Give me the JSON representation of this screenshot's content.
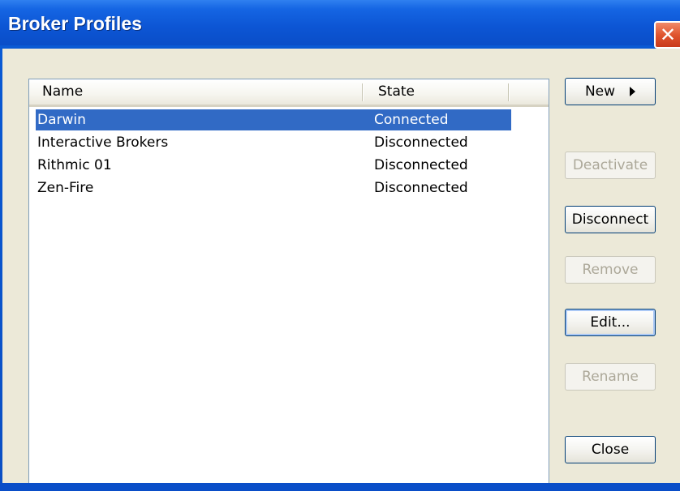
{
  "window": {
    "title": "Broker Profiles",
    "close_icon": "close-icon"
  },
  "list": {
    "columns": [
      "Name",
      "State"
    ],
    "rows": [
      {
        "name": "Darwin",
        "state": "Connected",
        "selected": true
      },
      {
        "name": "Interactive Brokers",
        "state": "Disconnected",
        "selected": false
      },
      {
        "name": "Rithmic 01",
        "state": "Disconnected",
        "selected": false
      },
      {
        "name": "Zen-Fire",
        "state": "Disconnected",
        "selected": false
      }
    ]
  },
  "buttons": {
    "new": "New",
    "deactivate": "Deactivate",
    "disconnect": "Disconnect",
    "remove": "Remove",
    "edit": "Edit...",
    "rename": "Rename",
    "close": "Close"
  },
  "colors": {
    "titlebar": "#0c55d4",
    "selection": "#316ac5",
    "dialog_bg": "#ece9d8"
  }
}
